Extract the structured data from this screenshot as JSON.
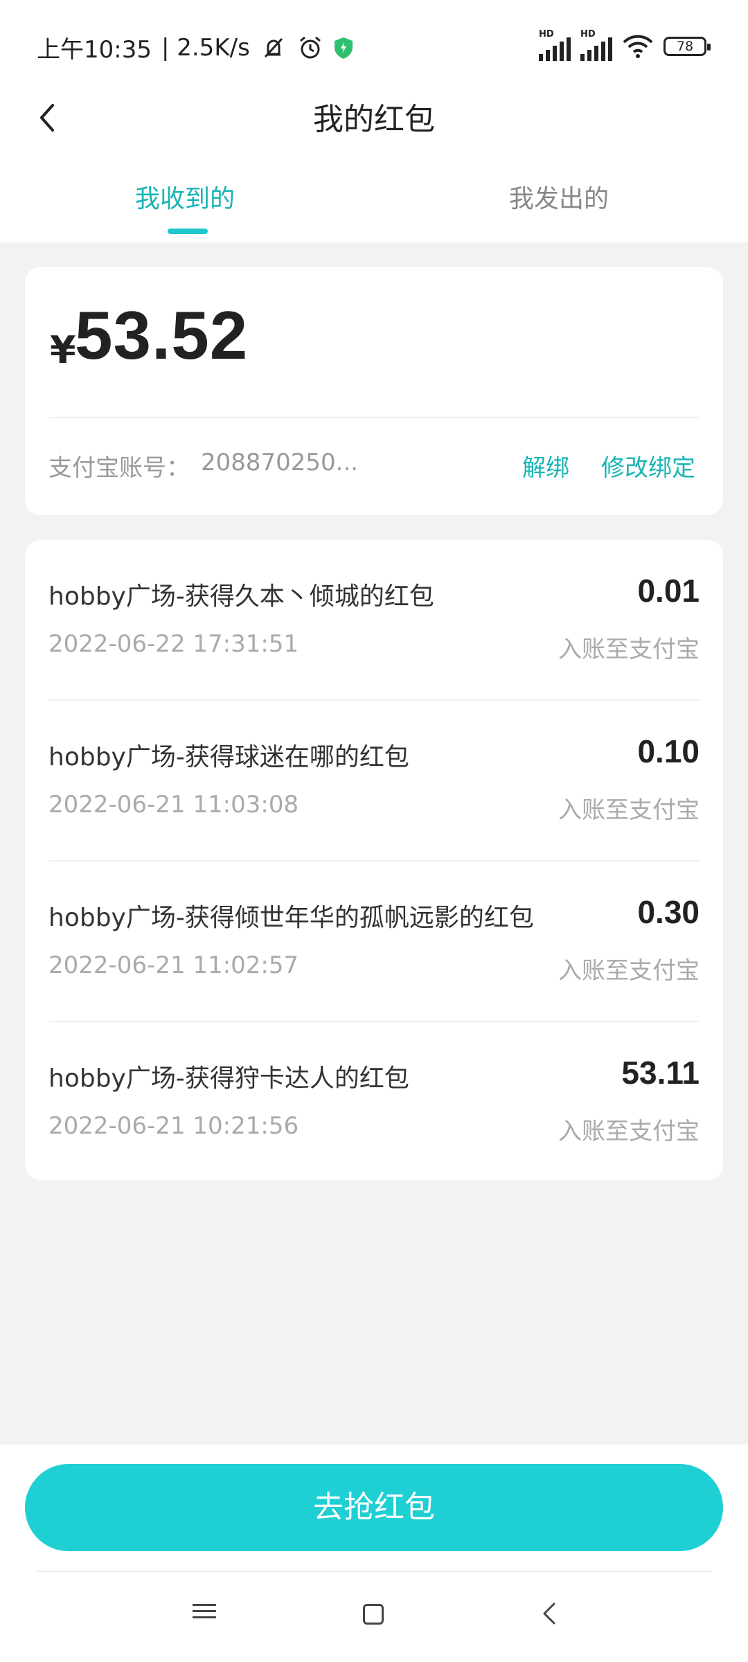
{
  "status_bar": {
    "time": "上午10:35",
    "net_speed": "| 2.5K/s",
    "signal1_label": "HD",
    "signal2_label": "HD",
    "battery": "78"
  },
  "header": {
    "title": "我的红包"
  },
  "tabs": [
    {
      "label": "我收到的",
      "active": true
    },
    {
      "label": "我发出的",
      "active": false
    }
  ],
  "balance": {
    "currency": "¥",
    "amount": "53.52",
    "account_label": "支付宝账号：",
    "account_number": "208870250...",
    "unbind": "解绑",
    "modify": "修改绑定"
  },
  "records": [
    {
      "title": "hobby广场-获得久本丶倾城的红包",
      "amount": "0.01",
      "time": "2022-06-22 17:31:51",
      "status": "入账至支付宝"
    },
    {
      "title": "hobby广场-获得球迷在哪的红包",
      "amount": "0.10",
      "time": "2022-06-21 11:03:08",
      "status": "入账至支付宝"
    },
    {
      "title": "hobby广场-获得倾世年华的孤帆远影的红包",
      "amount": "0.30",
      "time": "2022-06-21 11:02:57",
      "status": "入账至支付宝"
    },
    {
      "title": "hobby广场-获得狩卡达人的红包",
      "amount": "53.11",
      "time": "2022-06-21 10:21:56",
      "status": "入账至支付宝"
    }
  ],
  "action_button": "去抢红包",
  "colors": {
    "accent": "#19b4b4",
    "button": "#1ecfd4"
  }
}
